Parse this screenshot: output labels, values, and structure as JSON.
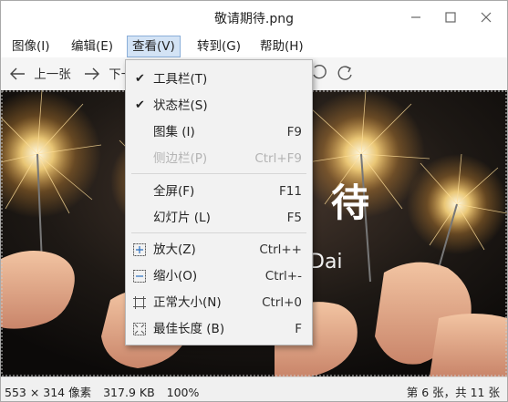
{
  "window": {
    "title": "敬请期待.png"
  },
  "menubar": {
    "items": [
      {
        "label": "图像(I)"
      },
      {
        "label": "编辑(E)"
      },
      {
        "label": "查看(V)"
      },
      {
        "label": "转到(G)"
      },
      {
        "label": "帮助(H)"
      }
    ]
  },
  "toolbar": {
    "prev_label": "上一张",
    "next_label": "下一"
  },
  "view_menu": {
    "items": [
      {
        "label": "工具栏(T)",
        "shortcut": "",
        "checked": true,
        "icon": "check-icon"
      },
      {
        "label": "状态栏(S)",
        "shortcut": "",
        "checked": true,
        "icon": "check-icon"
      },
      {
        "label": "图集 (I)",
        "shortcut": "F9"
      },
      {
        "label": "侧边栏(P)",
        "shortcut": "Ctrl+F9",
        "disabled": true
      },
      {
        "label": "全屏(F)",
        "shortcut": "F11"
      },
      {
        "label": "幻灯片 (L)",
        "shortcut": "F5"
      },
      {
        "label": "放大(Z)",
        "shortcut": "Ctrl++",
        "icon": "zoom-in-icon"
      },
      {
        "label": "缩小(O)",
        "shortcut": "Ctrl+-",
        "icon": "zoom-out-icon"
      },
      {
        "label": "正常大小(N)",
        "shortcut": "Ctrl+0",
        "icon": "original-size-icon"
      },
      {
        "label": "最佳长度 (B)",
        "shortcut": "F",
        "icon": "best-fit-icon"
      }
    ]
  },
  "image_overlay": {
    "text_large": "待",
    "text_small": "Dai"
  },
  "statusbar": {
    "dimensions": "553 × 314 像素",
    "file_size": "317.9 KB",
    "zoom": "100%",
    "position": "第 6 张，共 11 张"
  },
  "colors": {
    "menu_highlight": "#d3e3f5",
    "menu_highlight_border": "#8aaed9"
  }
}
